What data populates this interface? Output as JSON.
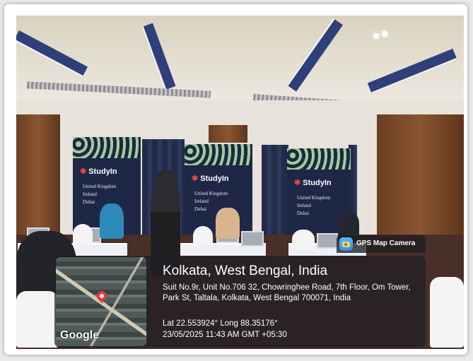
{
  "banner": {
    "brand": "StudyIn",
    "countries": [
      "United Kingdom",
      "Ireland",
      "Dubai"
    ]
  },
  "stamp": {
    "app_name": "GPS Map Camera",
    "map_logo": "Google",
    "title": "Kolkata, West Bengal, India",
    "address": "Suit No.9r, Unit No.706 32, Chowringhee Road, 7th Floor, Om Tower, Park St, Taltala, Kolkata, West Bengal 700071, India",
    "coordinates": "Lat 22.553924° Long 88.35176°",
    "datetime": "23/05/2025 11:43 AM GMT +05:30"
  },
  "icons": [
    "gps-map-camera-icon",
    "map-pin-icon"
  ],
  "colors": {
    "banner_navy": "#1f2747",
    "pin_red": "#e53935",
    "overlay": "#1e1e24"
  }
}
